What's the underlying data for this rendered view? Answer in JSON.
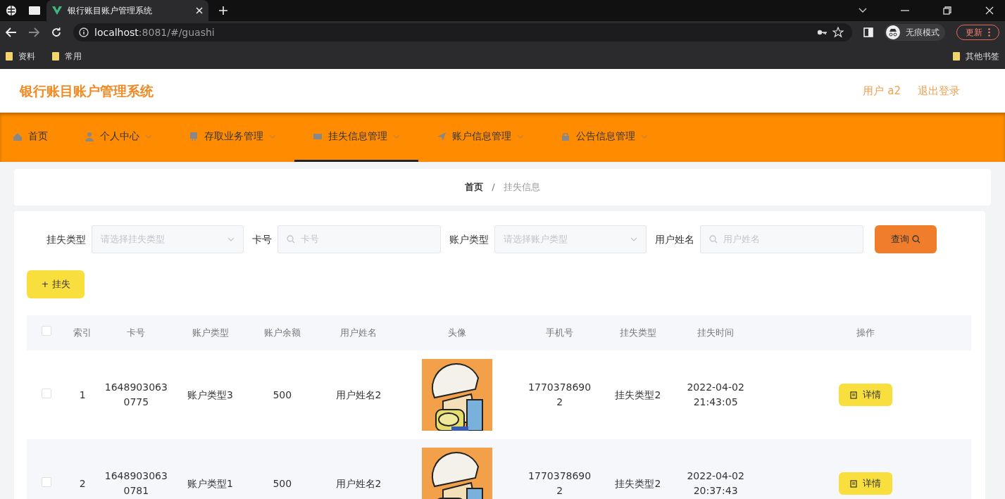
{
  "browser": {
    "tab_title": "银行账目账户管理系统",
    "url_host": "localhost",
    "url_rest": ":8081/#/guashi",
    "bookmarks": [
      "资料",
      "常用"
    ],
    "other_bookmarks": "其他书签",
    "incognito_label": "无痕模式",
    "update_button": "更新"
  },
  "header": {
    "title": "银行账目账户管理系统",
    "user": "用户 a2",
    "logout": "退出登录"
  },
  "nav": [
    {
      "label": "首页",
      "selected": false,
      "dropdown": false
    },
    {
      "label": "个人中心",
      "selected": false,
      "dropdown": true
    },
    {
      "label": "存取业务管理",
      "selected": false,
      "dropdown": true
    },
    {
      "label": "挂失信息管理",
      "selected": true,
      "dropdown": true
    },
    {
      "label": "账户信息管理",
      "selected": false,
      "dropdown": true
    },
    {
      "label": "公告信息管理",
      "selected": false,
      "dropdown": true
    }
  ],
  "breadcrumb": [
    "首页",
    "挂失信息"
  ],
  "breadcrumb_separator": "/",
  "filters": [
    {
      "label": "挂失类型",
      "kind": "select",
      "placeholder": "请选择挂失类型"
    },
    {
      "label": "卡号",
      "kind": "input",
      "placeholder": "卡号"
    },
    {
      "label": "账户类型",
      "kind": "select",
      "placeholder": "请选择账户类型"
    },
    {
      "label": "用户姓名",
      "kind": "input",
      "placeholder": "用户姓名"
    }
  ],
  "search_button": "查询",
  "add_button": "+ 挂失",
  "table": {
    "all_checked": false,
    "columns": [
      "索引",
      "卡号",
      "账户类型",
      "账户余额",
      "用户姓名",
      "头像",
      "手机号",
      "挂失类型",
      "挂失时间",
      "操作"
    ],
    "rows": [
      {
        "checked": false,
        "index": "1",
        "card": "1648903063\n0775",
        "account_type": "账户类型3",
        "balance": "500",
        "name": "用户姓名2",
        "phone": "1770378690\n2",
        "loss_type": "挂失类型2",
        "time": "2022-04-02\n21:43:05",
        "action": "详情"
      },
      {
        "checked": false,
        "index": "2",
        "card": "1648903063\n0781",
        "account_type": "账户类型1",
        "balance": "500",
        "name": "用户姓名2",
        "phone": "1770378690\n2",
        "loss_type": "挂失类型2",
        "time": "2022-04-02\n20:37:43",
        "action": "详情"
      }
    ]
  }
}
